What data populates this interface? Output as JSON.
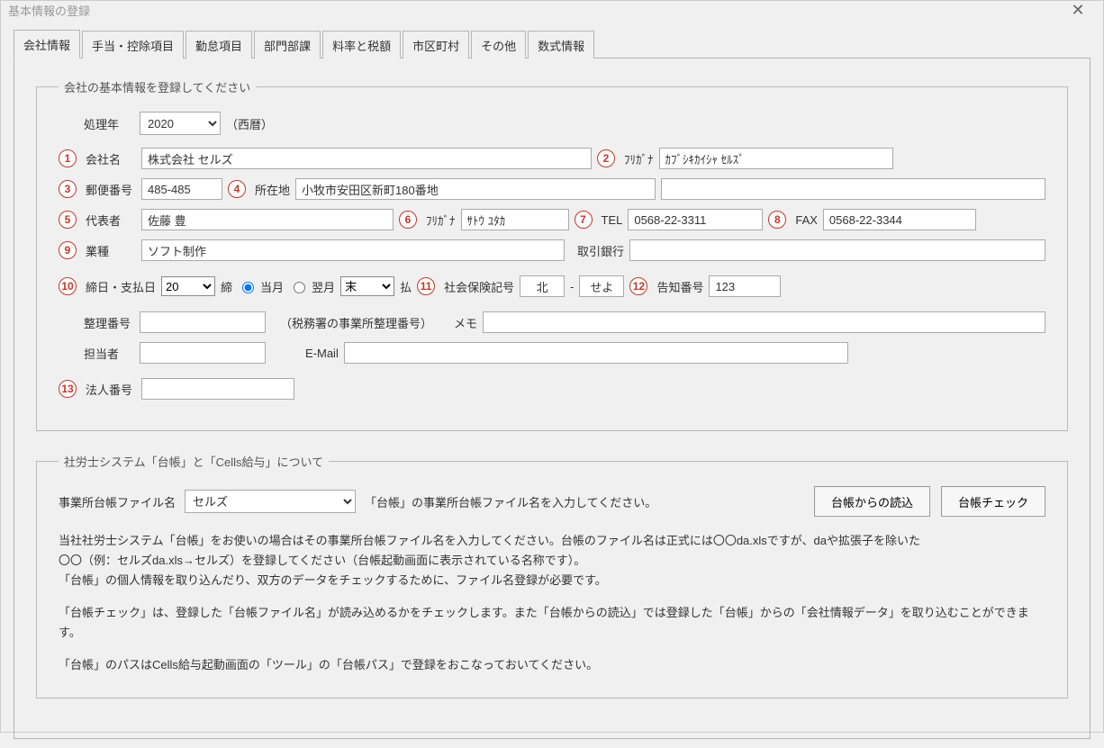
{
  "window": {
    "title": "基本情報の登録",
    "close_icon": "✕"
  },
  "tabs": [
    "会社情報",
    "手当・控除項目",
    "勤怠項目",
    "部門部課",
    "料率と税額",
    "市区町村",
    "その他",
    "数式情報"
  ],
  "group1": {
    "legend": "会社の基本情報を登録してください",
    "year_label": "処理年",
    "year_value": "2020",
    "year_suffix": "（西暦）",
    "company_label": "会社名",
    "company_value": "株式会社 セルズ",
    "furigana_label": "ﾌﾘｶﾞﾅ",
    "furigana_value": "ｶﾌﾞｼｷｶｲｼｬ ｾﾙｽﾞ",
    "postal_label": "郵便番号",
    "postal_value": "485-485",
    "address_label": "所在地",
    "address_value": "小牧市安田区新町180番地",
    "address_value2": "",
    "rep_label": "代表者",
    "rep_value": "佐藤 豊",
    "rep_furigana_label": "ﾌﾘｶﾞﾅ",
    "rep_furigana_value": "ｻﾄｳ ﾕﾀｶ",
    "tel_label": "TEL",
    "tel_value": "0568-22-3311",
    "fax_label": "FAX",
    "fax_value": "0568-22-3344",
    "gyoshu_label": "業種",
    "gyoshu_value": "ソフト制作",
    "bank_label": "取引銀行",
    "bank_value": "",
    "shime_label": "締日・支払日",
    "shime_value": "20",
    "shime_suffix": "締",
    "tougetsu": "当月",
    "yokugetsu": "翌月",
    "harai_value": "末",
    "harai_suffix": "払",
    "shakaihoken_label": "社会保険記号",
    "shakaihoken_value1": "北",
    "shakaihoken_value2": "せよ",
    "kokuchi_label": "告知番号",
    "kokuchi_value": "123",
    "seiri_label": "整理番号",
    "seiri_value": "",
    "seiri_note": "（税務署の事業所整理番号）",
    "memo_label": "メモ",
    "memo_value": "",
    "tantou_label": "担当者",
    "tantou_value": "",
    "email_label": "E-Mail",
    "email_value": "",
    "houjin_label": "法人番号",
    "houjin_value": ""
  },
  "group2": {
    "legend": "社労士システム「台帳」と「Cells給与」について",
    "daicho_file_label": "事業所台帳ファイル名",
    "daicho_file_value": "セルズ",
    "daicho_file_note": "「台帳」の事業所台帳ファイル名を入力してください。",
    "btn_import": "台帳からの読込",
    "btn_check": "台帳チェック",
    "help1_line1": "当社社労士システム「台帳」をお使いの場合はその事業所台帳ファイル名を入力してください。台帳のファイル名は正式には〇〇da.xlsですが、daや拡張子を除いた",
    "help1_line2": "〇〇（例：セルズda.xls→セルズ）を登録してください（台帳起動画面に表示されている名称です）。",
    "help1_line3": "「台帳」の個人情報を取り込んだり、双方のデータをチェックするために、ファイル名登録が必要です。",
    "help2": "「台帳チェック」は、登録した「台帳ファイル名」が読み込めるかをチェックします。また「台帳からの読込」では登録した「台帳」からの「会社情報データ」を取り込むことができます。",
    "help3": "「台帳」のパスはCells給与起動画面の「ツール」の「台帳パス」で登録をおこなっておいてください。"
  },
  "badges": {
    "n1": "1",
    "n2": "2",
    "n3": "3",
    "n4": "4",
    "n5": "5",
    "n6": "6",
    "n7": "7",
    "n8": "8",
    "n9": "9",
    "n10": "10",
    "n11": "11",
    "n12": "12",
    "n13": "13"
  }
}
